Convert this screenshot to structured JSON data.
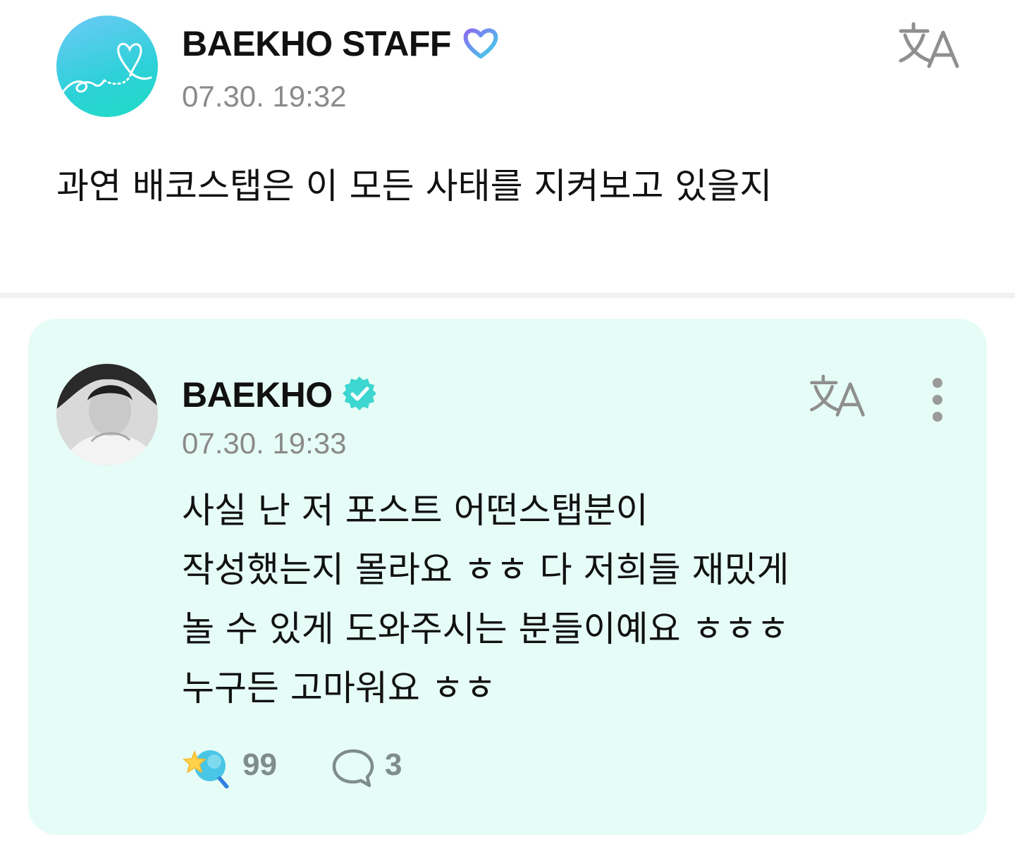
{
  "post": {
    "author": "BAEKHO STAFF",
    "timestamp": "07.30. 19:32",
    "text": "과연 배코스탭은 이 모든 사태를 지켜보고 있을지",
    "avatar_icon": "heart-ribbon-logo",
    "badge_icon": "heart-badge-icon",
    "translate_icon": "translate-icon"
  },
  "reply": {
    "author": "BAEKHO",
    "timestamp": "07.30. 19:33",
    "lines": [
      "사실 난 저 포스트 어떤스탭분이",
      "작성했는지 몰라요 ㅎㅎ 다 저희들 재밌게",
      "놀 수 있게 도와주시는 분들이예요 ㅎㅎㅎ",
      "누구든 고마워요 ㅎㅎ"
    ],
    "likes": "99",
    "comments": "3",
    "verified_icon": "verified-check-icon",
    "card_color": "#e6fcf6"
  },
  "colors": {
    "accent": "#3dd6d0",
    "muted": "#8a8a8a",
    "count": "#7f8c8c"
  }
}
